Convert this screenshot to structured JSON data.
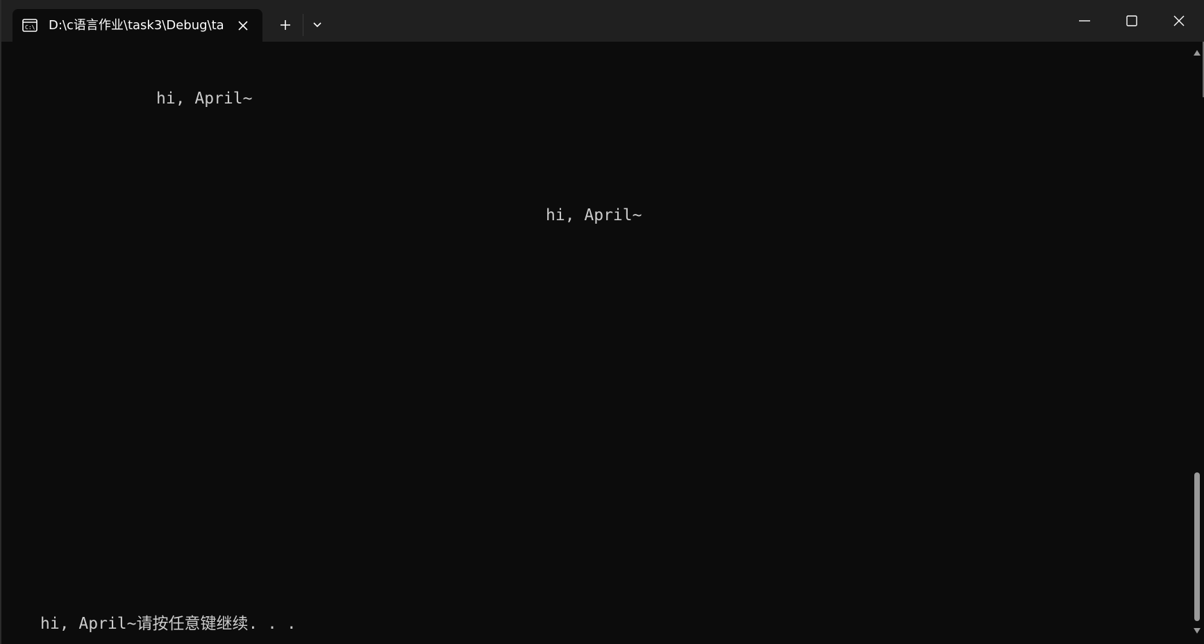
{
  "tab": {
    "title": "D:\\c语言作业\\task3\\Debug\\ta",
    "icon": "cmd-icon"
  },
  "titlebar_controls": {
    "new_tab_icon": "plus-icon",
    "dropdown_icon": "chevron-down-icon",
    "minimize_icon": "minimize-icon",
    "maximize_icon": "maximize-icon",
    "close_icon": "close-icon"
  },
  "terminal": {
    "lines": [
      "hi, April~",
      "hi, April~",
      "hi, April~请按任意键继续. . ."
    ],
    "text_color": "#cccccc",
    "background": "#0c0c0c"
  },
  "colors": {
    "titlebar": "#202020",
    "active_tab": "#0c0c0c",
    "scroll_thumb": "#9a9a9a"
  }
}
